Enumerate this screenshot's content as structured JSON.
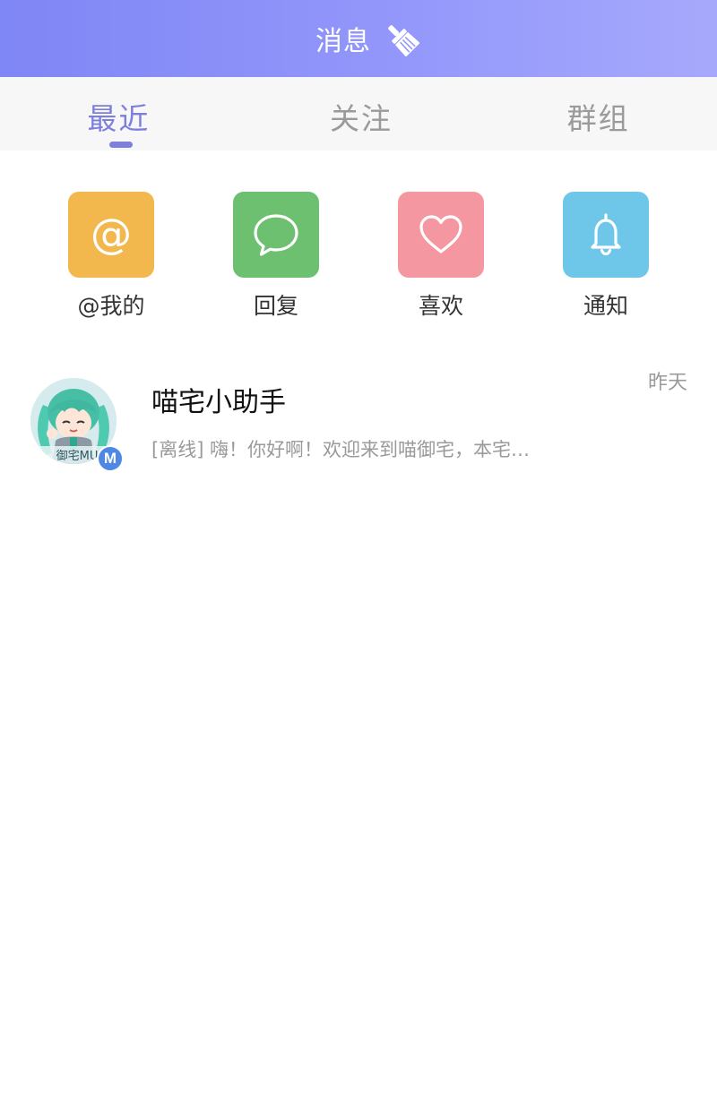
{
  "header": {
    "title": "消息",
    "clear_icon": "broom-icon"
  },
  "tabs": [
    {
      "label": "最近",
      "active": true
    },
    {
      "label": "关注",
      "active": false
    },
    {
      "label": "群组",
      "active": false
    }
  ],
  "quick_actions": [
    {
      "label": "@我的",
      "icon": "at-icon",
      "color": "#f2b84d"
    },
    {
      "label": "回复",
      "icon": "chat-bubble-icon",
      "color": "#6cc070"
    },
    {
      "label": "喜欢",
      "icon": "heart-icon",
      "color": "#f497a0"
    },
    {
      "label": "通知",
      "icon": "bell-icon",
      "color": "#6ec6e8"
    }
  ],
  "conversations": [
    {
      "name": "喵宅小助手",
      "time": "昨天",
      "preview": "[离线] 嗨！你好啊！欢迎来到喵御宅，本宅…",
      "badge": "M",
      "avatar_caption": "御宅MU"
    }
  ],
  "colors": {
    "header_start": "#7f86f5",
    "header_end": "#a6a9fb",
    "tab_active": "#7d7fdc",
    "tab_inactive": "#9a9a9a",
    "badge": "#4e88e6"
  }
}
